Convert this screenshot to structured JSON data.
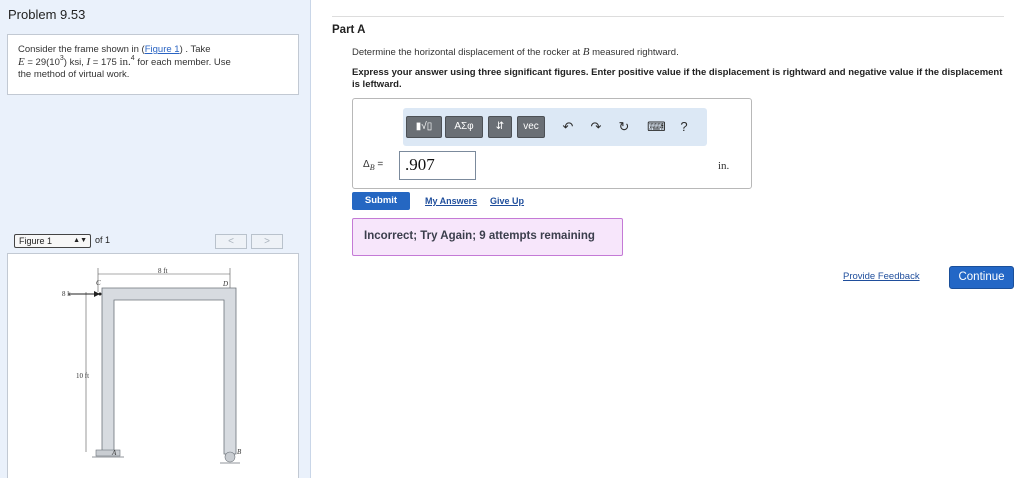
{
  "problem": {
    "title": "Problem 9.53",
    "text_prefix": "Consider the frame shown in (",
    "figure_link": "Figure 1",
    "text_suffix": ") . Take",
    "e_line_1": "E",
    "e_line_2": " = 29(10",
    "e_exp": "3",
    "e_line_3": ") ksi, ",
    "i_var": "I",
    "i_line": " = 175 ",
    "i_unit": "in.",
    "i_exp": "4",
    "i_suffix": " for each member. Use",
    "last_line": "the method of virtual work."
  },
  "figure": {
    "selected": "Figure 1",
    "of_text": "of 1",
    "prev_label": "<",
    "next_label": ">",
    "labels": {
      "width": "8 ft",
      "height": "10 ft",
      "force": "8 k",
      "c": "C",
      "d": "D",
      "a": "A",
      "b": "B"
    }
  },
  "part": {
    "title": "Part A",
    "question_prefix": "Determine the horizontal displacement of the rocker at ",
    "question_var": "B",
    "question_suffix": " measured rightward.",
    "instruction": "Express your answer using three significant figures. Enter positive value if the displacement is rightward and negative value if the displacement is leftward."
  },
  "toolbar": {
    "template_label": "▮√▯",
    "greek_label": "ΑΣφ",
    "arrows_label": "⇵",
    "vec_label": "vec",
    "undo_icon": "↶",
    "redo_icon": "↷",
    "reset_icon": "↻",
    "keyboard_icon": "⌨",
    "help_icon": "?"
  },
  "answer": {
    "delta_label": "Δ",
    "delta_sub": "B",
    "equals": " =",
    "value": ".907",
    "unit": "in."
  },
  "actions": {
    "submit": "Submit",
    "my_answers": "My Answers",
    "give_up": "Give Up"
  },
  "feedback": {
    "message": "Incorrect; Try Again; 9 attempts remaining"
  },
  "footer": {
    "provide_feedback": "Provide Feedback",
    "continue": "Continue"
  }
}
